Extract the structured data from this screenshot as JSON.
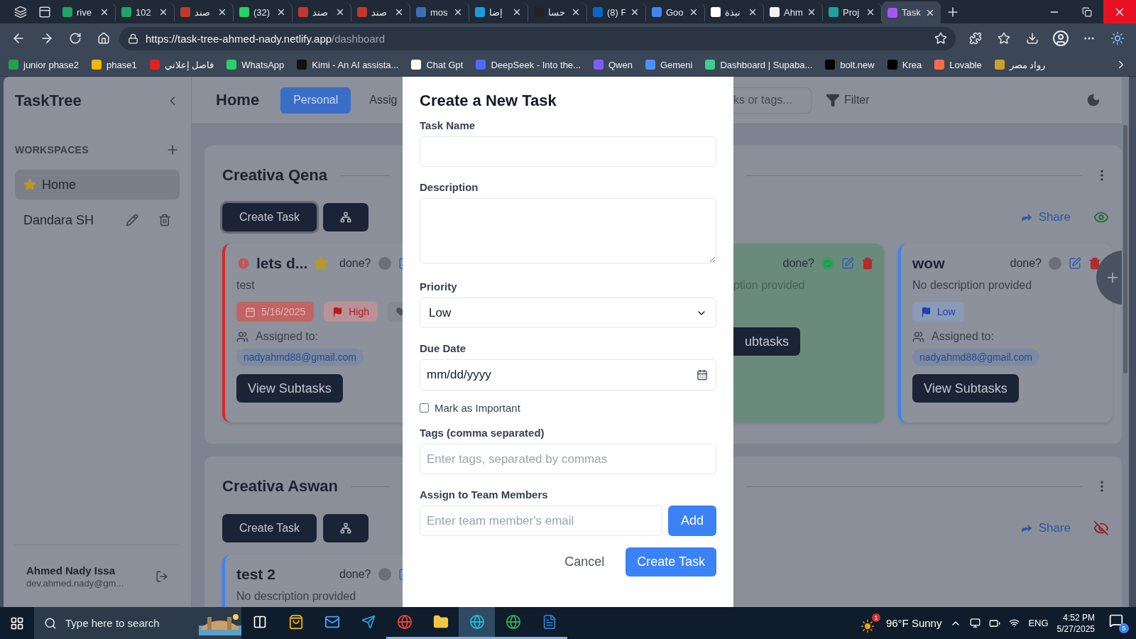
{
  "browser": {
    "tabs": [
      {
        "title": "rive",
        "color": "#1fa463",
        "selected": false
      },
      {
        "title": "102",
        "color": "#1fa463",
        "selected": false
      },
      {
        "title": "صند",
        "color": "#c0392b",
        "selected": false
      },
      {
        "title": "(32)",
        "color": "#25d366",
        "selected": false
      },
      {
        "title": "صند",
        "color": "#c0392b",
        "selected": false
      },
      {
        "title": "صند",
        "color": "#c0392b",
        "selected": false
      },
      {
        "title": "mos",
        "color": "#3b6fb6",
        "selected": false
      },
      {
        "title": "إضا",
        "color": "#1a9be0",
        "selected": false
      },
      {
        "title": "حسا",
        "color": "#222222",
        "selected": false
      },
      {
        "title": "(8) F",
        "color": "#0a66c2",
        "selected": false
      },
      {
        "title": "Goo",
        "color": "#4285f4",
        "selected": false
      },
      {
        "title": "نبذة",
        "color": "#ffffff",
        "selected": false
      },
      {
        "title": "Ahm",
        "color": "#f0f0f0",
        "selected": false
      },
      {
        "title": "Proj",
        "color": "#1aa39a",
        "selected": false
      },
      {
        "title": "Task",
        "color": "#a855f7",
        "selected": true
      }
    ],
    "address": {
      "host": "https://task-tree-ahmed-nady.netlify.app",
      "path": "/dashboard"
    },
    "bookmarks": [
      {
        "label": "junior phase2",
        "color": "#22a04b"
      },
      {
        "label": "phase1",
        "color": "#f4b400"
      },
      {
        "label": "فاصل إعلاني",
        "color": "#dd2222"
      },
      {
        "label": "WhatsApp",
        "color": "#25d366"
      },
      {
        "label": "Kimi - An AI assista...",
        "color": "#111111"
      },
      {
        "label": "Chat Gpt",
        "color": "#ffffff"
      },
      {
        "label": "DeepSeek - Into the...",
        "color": "#4d6bfe"
      },
      {
        "label": "Qwen",
        "color": "#7c5cff"
      },
      {
        "label": "Gemeni",
        "color": "#4b90ff"
      },
      {
        "label": "Dashboard | Supaba...",
        "color": "#3ecf8e"
      },
      {
        "label": "bolt.new",
        "color": "#000000"
      },
      {
        "label": "Krea",
        "color": "#000000"
      },
      {
        "label": "Lovable",
        "color": "#ff6b4a"
      },
      {
        "label": "رواد مصر",
        "color": "#c9a227"
      }
    ]
  },
  "sidebar": {
    "title": "TaskTree",
    "section": "WORKSPACES",
    "workspaces": [
      {
        "name": "Home",
        "selected": true,
        "starred": true
      },
      {
        "name": "Dandara SH",
        "selected": false,
        "starred": false
      }
    ],
    "user": {
      "name": "Ahmed Nady Issa",
      "email": "dev.ahmed.nady@gm..."
    }
  },
  "header": {
    "title": "Home",
    "tabs": [
      {
        "label": "Personal",
        "selected": true
      },
      {
        "label": "Assig",
        "selected": false
      }
    ],
    "search": {
      "placeholder": "ks or tags..."
    },
    "filter": "Filter"
  },
  "groups": [
    {
      "title": "Creativa Qena",
      "create_label": "Create Task",
      "share_label": "Share",
      "visible": true,
      "left_cards": [
        {
          "kind": "clipped-right",
          "title": "lets d...",
          "important": true,
          "starred": true,
          "done_label": "done?",
          "done": false,
          "description": "test",
          "color": "#dc2626",
          "due": "5/16/2025",
          "priority": {
            "label": "High",
            "color": "#b91c1c"
          },
          "has_tag": true,
          "assigned_label": "Assigned to:",
          "assignees": [
            "nadyahmd88@gmail.com"
          ],
          "button": "View Subtasks"
        }
      ],
      "right_cards": [
        {
          "kind": "clipped-left",
          "done_label": "done?",
          "done": true,
          "description": "ption provided",
          "color": "#6a8b7c",
          "button": "ubtasks"
        },
        {
          "kind": "full",
          "title": "wow",
          "done_label": "done?",
          "done": false,
          "description": "No description provided",
          "color": "#3b82f6",
          "priority": {
            "label": "Low",
            "color": "#1e40af"
          },
          "assigned_label": "Assigned to:",
          "assignees": [
            "nadyahmd88@gmail.com"
          ],
          "button": "View Subtasks"
        }
      ]
    },
    {
      "title": "Creativa Aswan",
      "create_label": "Create Task",
      "share_label": "Share",
      "visible": false,
      "left_cards": [
        {
          "kind": "clipped-right",
          "title": "test 2",
          "done_label": "done?",
          "done": false,
          "description": "No description provided",
          "color": "#3b82f6"
        }
      ]
    }
  ],
  "modal": {
    "title": "Create a New Task",
    "name": {
      "label": "Task Name"
    },
    "description": {
      "label": "Description"
    },
    "priority": {
      "label": "Priority",
      "value": "Low"
    },
    "due": {
      "label": "Due Date",
      "placeholder": "mm/dd/yyyy"
    },
    "important": {
      "label": "Mark as Important",
      "checked": false
    },
    "tags": {
      "label": "Tags (comma separated)",
      "placeholder": "Enter tags, separated by commas"
    },
    "assign": {
      "label": "Assign to Team Members",
      "placeholder": "Enter team member's email",
      "button": "Add"
    },
    "cancel": "Cancel",
    "submit": "Create Task"
  },
  "taskbar": {
    "search": "Type here to search",
    "apps": [
      {
        "open": false,
        "active": false
      },
      {
        "open": false,
        "active": false
      },
      {
        "open": false,
        "active": false
      },
      {
        "open": false,
        "active": false
      },
      {
        "open": true,
        "active": false
      },
      {
        "open": true,
        "active": false
      },
      {
        "open": true,
        "active": true
      },
      {
        "open": true,
        "active": false
      },
      {
        "open": true,
        "active": false
      }
    ],
    "weather": "96°F Sunny",
    "weather_badge": "1",
    "language": "ENG",
    "time": "4:52 PM",
    "date": "5/27/2025",
    "notifications": "5"
  }
}
